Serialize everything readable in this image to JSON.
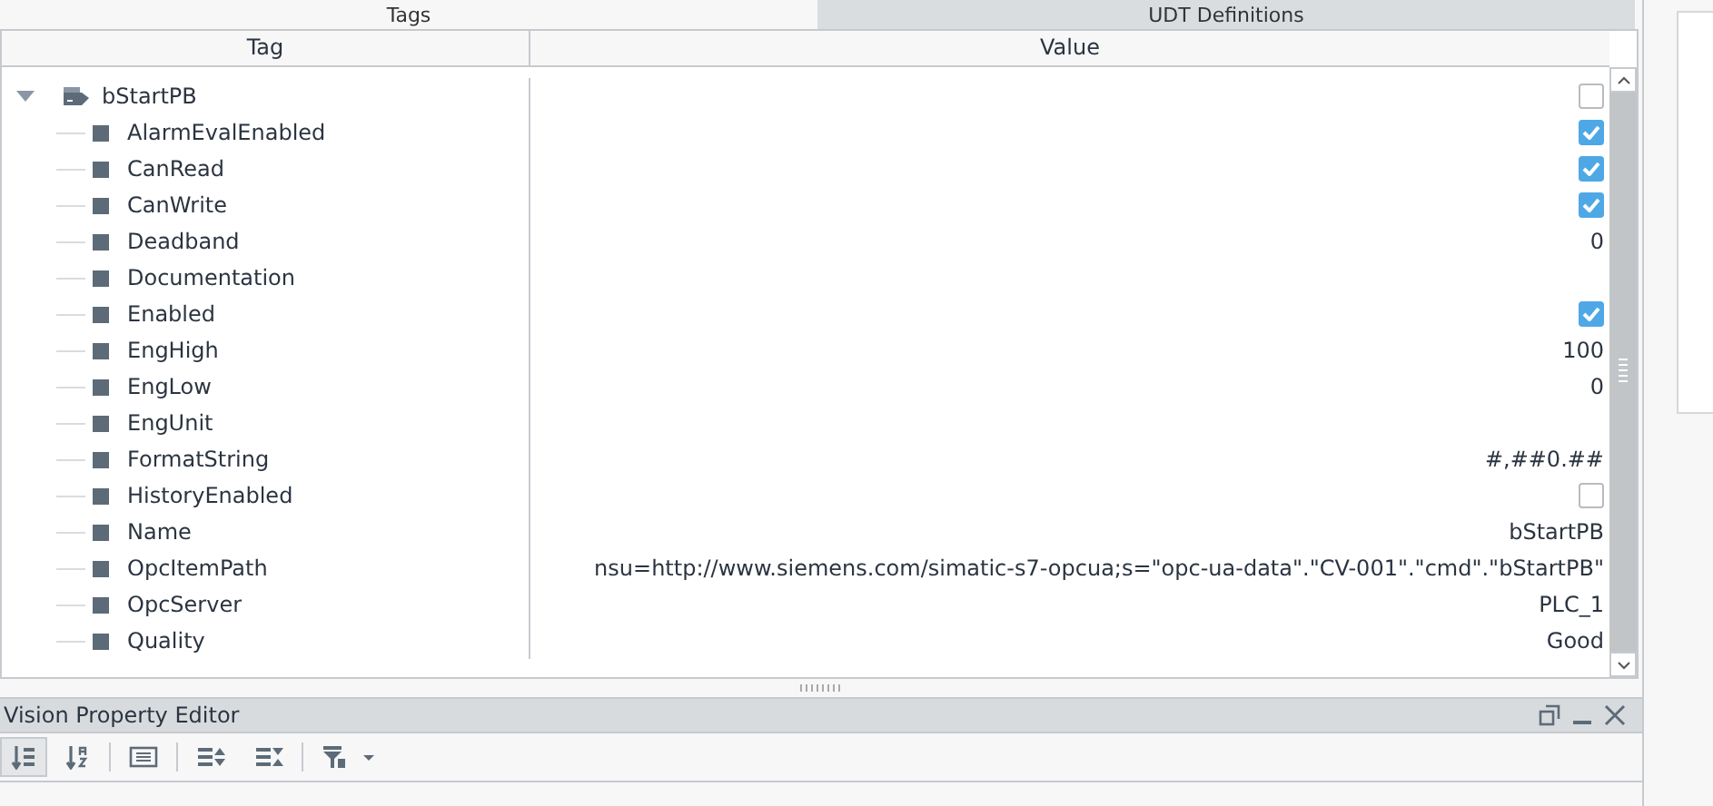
{
  "tabs": [
    {
      "label": "Tags",
      "selected": true
    },
    {
      "label": "UDT Definitions",
      "selected": false
    }
  ],
  "table": {
    "columns": [
      "Tag",
      "Value"
    ],
    "root": {
      "name": "bStartPB",
      "expanded": true,
      "kind": "checkbox",
      "checked": false,
      "children": [
        {
          "name": "AlarmEvalEnabled",
          "kind": "checkbox",
          "checked": true
        },
        {
          "name": "CanRead",
          "kind": "checkbox",
          "checked": true
        },
        {
          "name": "CanWrite",
          "kind": "checkbox",
          "checked": true
        },
        {
          "name": "Deadband",
          "kind": "text",
          "value": "0"
        },
        {
          "name": "Documentation",
          "kind": "text"
        },
        {
          "name": "Enabled",
          "kind": "checkbox",
          "checked": true
        },
        {
          "name": "EngHigh",
          "kind": "text",
          "value": "100"
        },
        {
          "name": "EngLow",
          "kind": "text",
          "value": "0"
        },
        {
          "name": "EngUnit",
          "kind": "text"
        },
        {
          "name": "FormatString",
          "kind": "text",
          "value": "#,##0.##"
        },
        {
          "name": "HistoryEnabled",
          "kind": "checkbox",
          "checked": false
        },
        {
          "name": "Name",
          "kind": "text",
          "value": "bStartPB"
        },
        {
          "name": "OpcItemPath",
          "kind": "text",
          "value": "nsu=http://www.siemens.com/simatic-s7-opcua;s=\"opc-ua-data\".\"CV-001\".\"cmd\".\"bStartPB\""
        },
        {
          "name": "OpcServer",
          "kind": "text",
          "value": "PLC_1"
        },
        {
          "name": "Quality",
          "kind": "text",
          "value": "Good"
        }
      ]
    }
  },
  "panel": {
    "title": "Vision Property Editor"
  }
}
